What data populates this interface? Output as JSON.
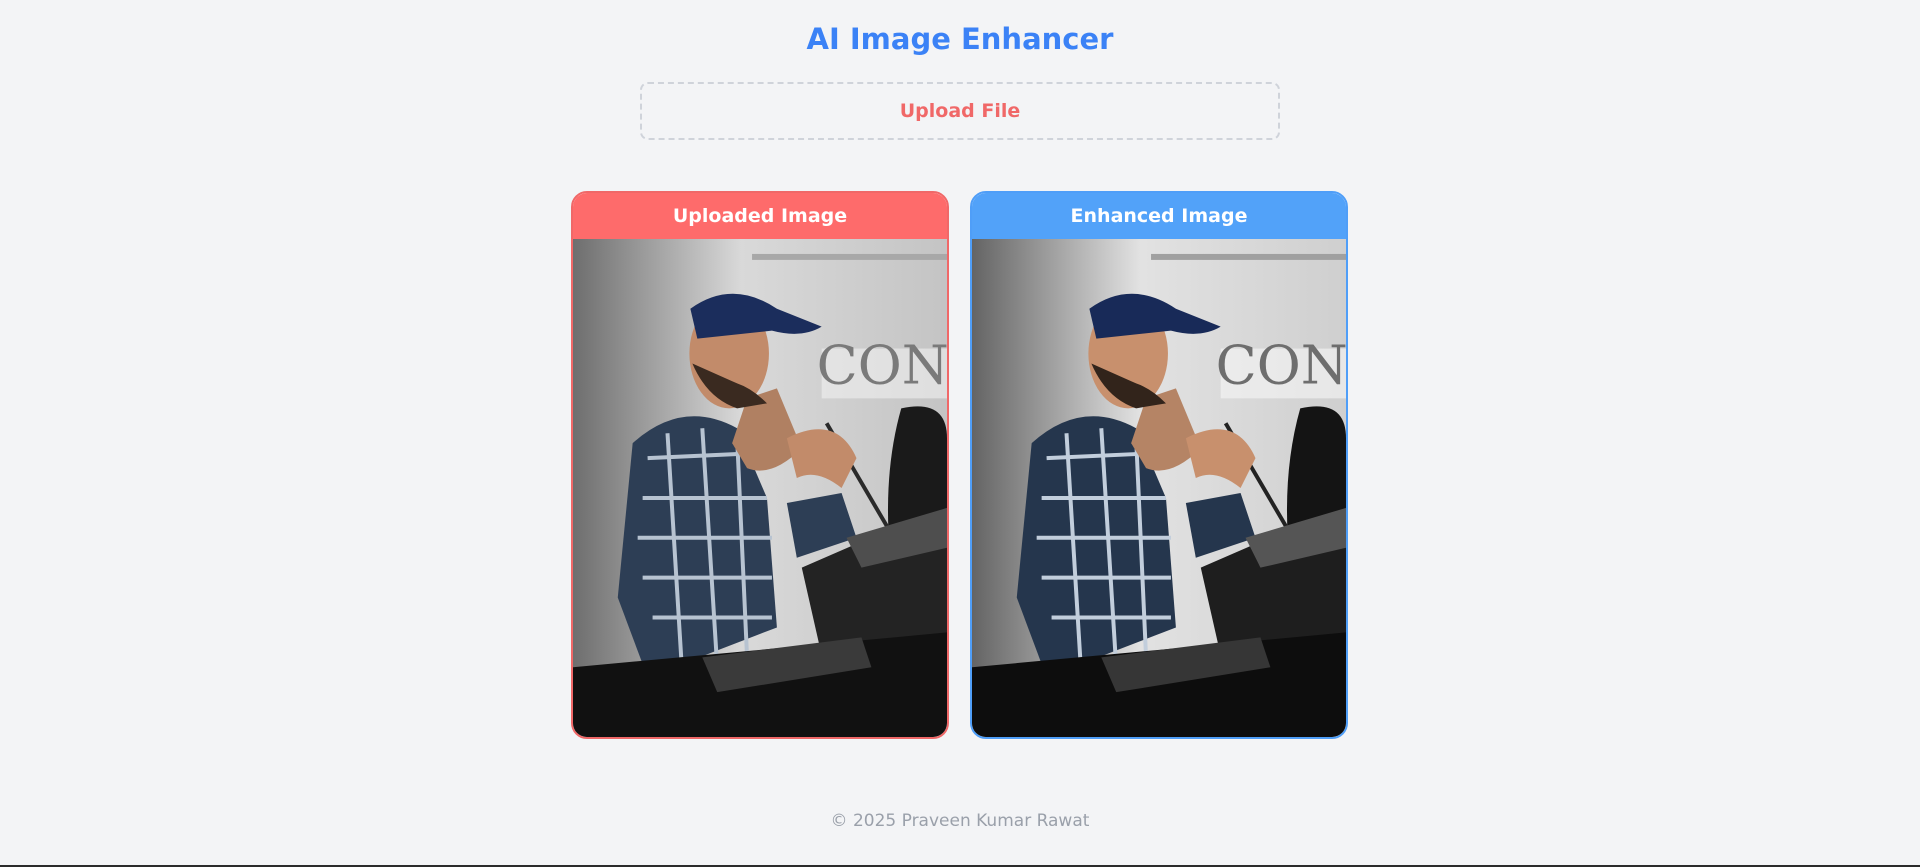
{
  "header": {
    "title": "AI Image Enhancer"
  },
  "upload": {
    "label": "Upload File"
  },
  "panels": {
    "original": {
      "title": "Uploaded Image",
      "accent": "#fe6b6b"
    },
    "enhanced": {
      "title": "Enhanced Image",
      "accent": "#52a2f9"
    }
  },
  "footer": {
    "text": "© 2025 Praveen Kumar Rawat"
  },
  "colors": {
    "title": "#3b82f6",
    "background": "#f3f4f6",
    "upload_text": "#f06868"
  }
}
